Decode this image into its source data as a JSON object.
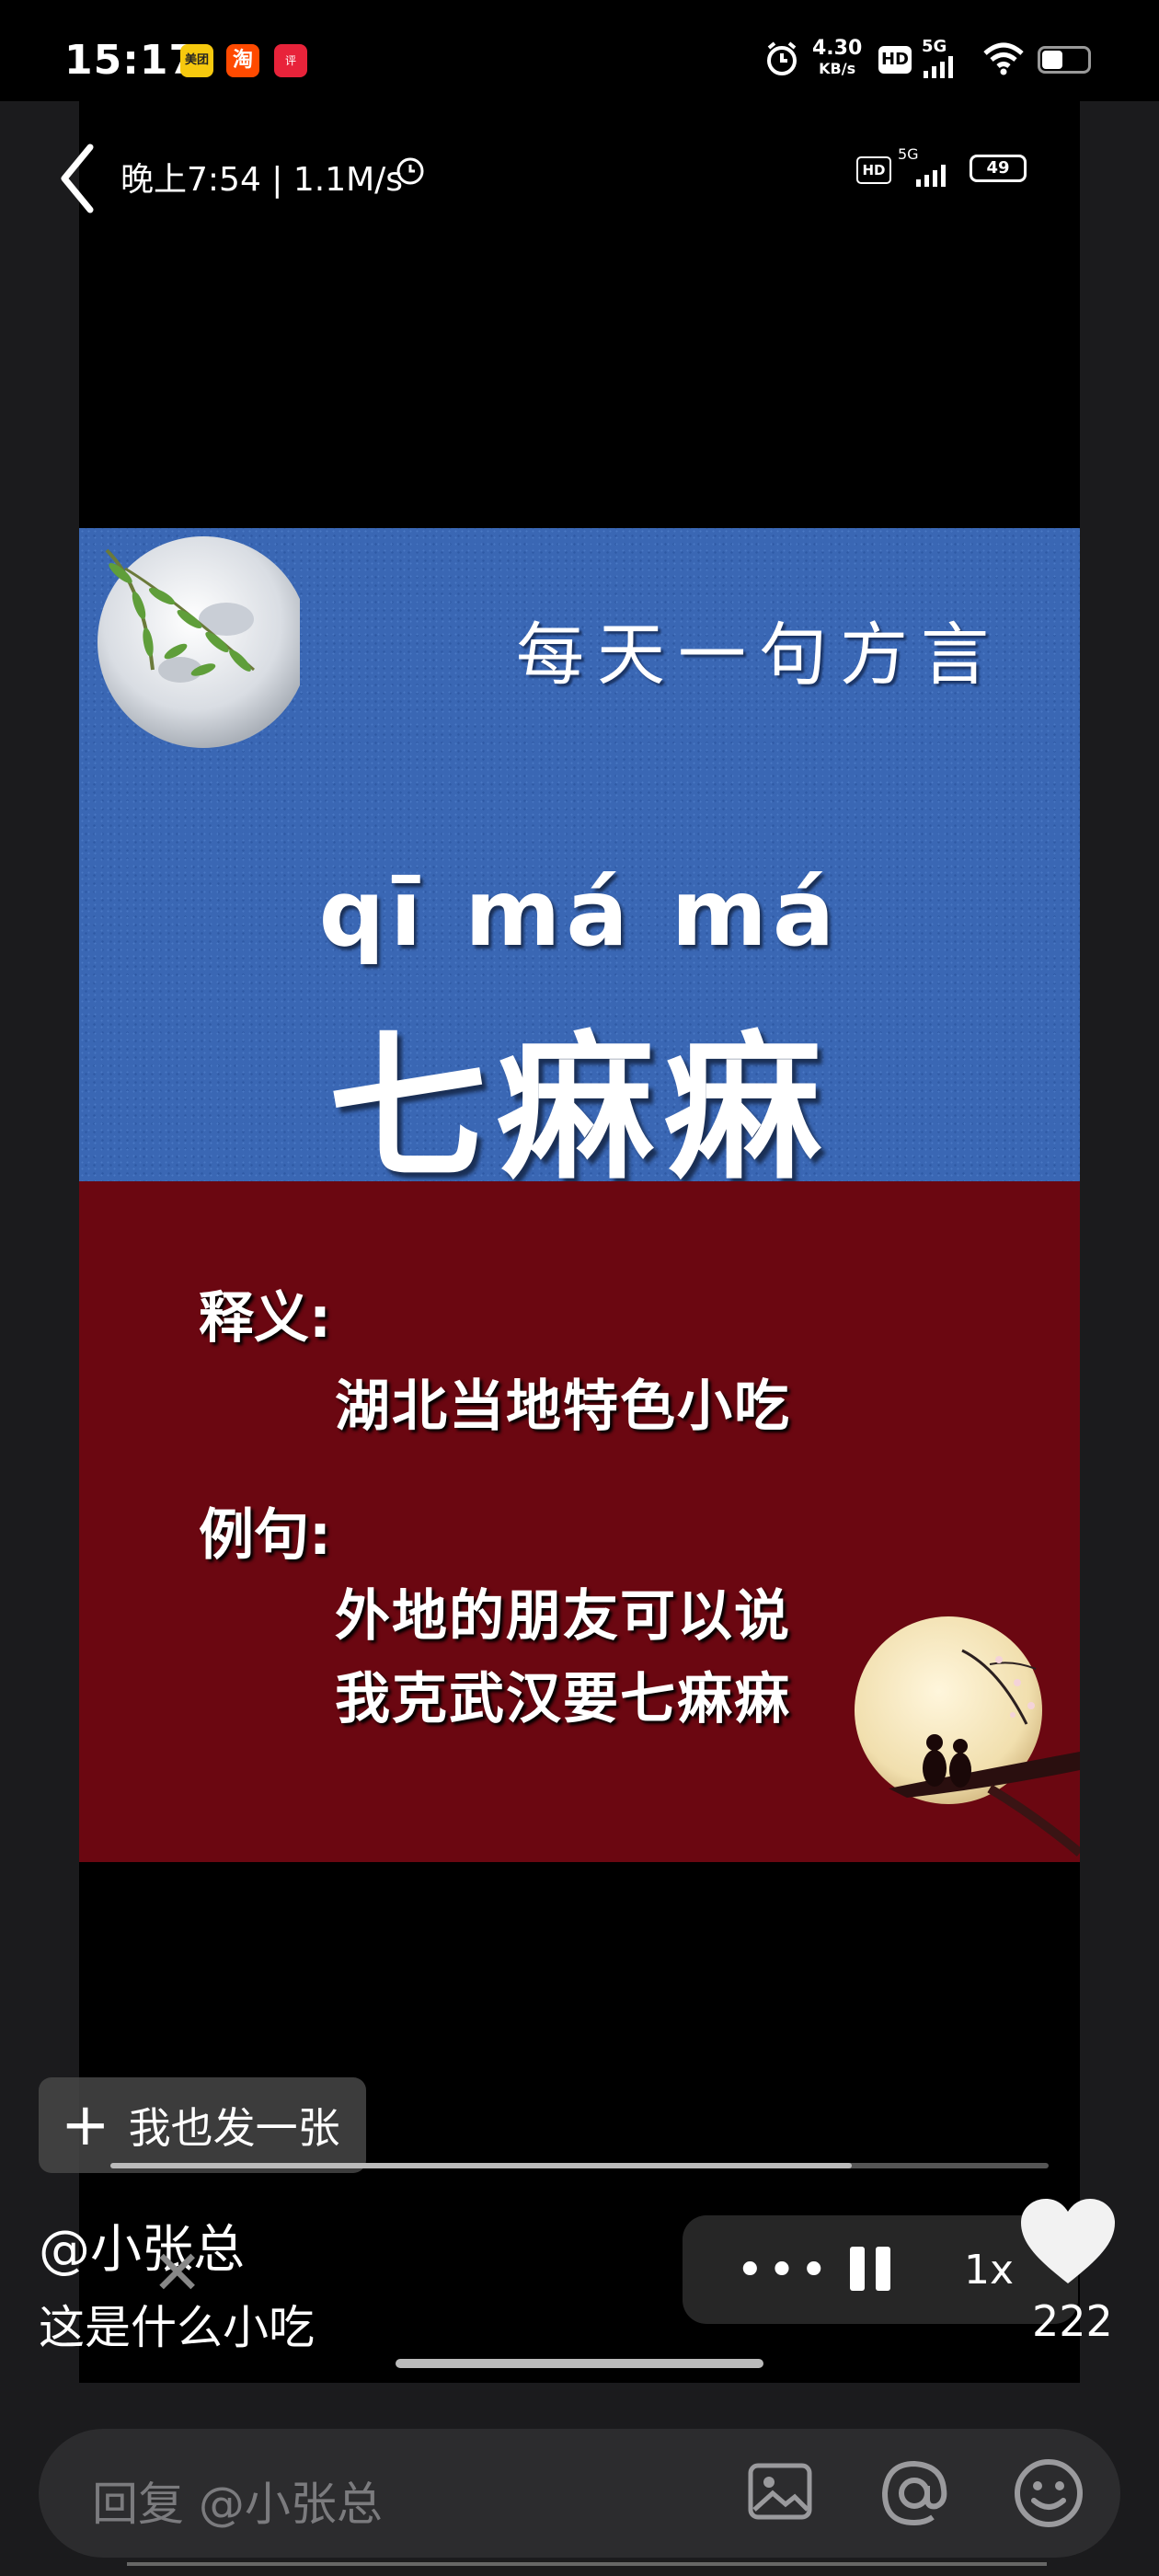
{
  "status_bar": {
    "time": "15:17",
    "app_icons": [
      "meituan-icon",
      "taobao-icon",
      "dianping-icon"
    ],
    "net_speed_value": "4.30",
    "net_speed_unit": "KB/s",
    "hd": "HD",
    "net_type": "5G",
    "icons": [
      "alarm-icon",
      "hd-icon",
      "signal-icon",
      "wifi-icon",
      "battery-icon"
    ]
  },
  "image": {
    "inner_status": {
      "time_speed": "晚上7:54 | 1.1M/s",
      "hd": "HD",
      "net_type": "5G",
      "battery": "49"
    },
    "slogan": "每天一句方言",
    "pinyin": "qī má má",
    "hanzi": "七痳痳",
    "meaning_label": "释义:",
    "meaning_text": "湖北当地特色小吃",
    "example_label": "例句:",
    "example_line1": "外地的朋友可以说",
    "example_line2": "我克武汉要七痳痳"
  },
  "overlay": {
    "post_button": "我也发一张",
    "progress": 0.79,
    "author": "@小张总",
    "caption": "这是什么小吃",
    "speed": "1x",
    "like_count": "222"
  },
  "reply": {
    "placeholder": "回复 @小张总"
  },
  "colors": {
    "blue_panel": "#3a67b4",
    "red_panel": "#6b0711"
  }
}
